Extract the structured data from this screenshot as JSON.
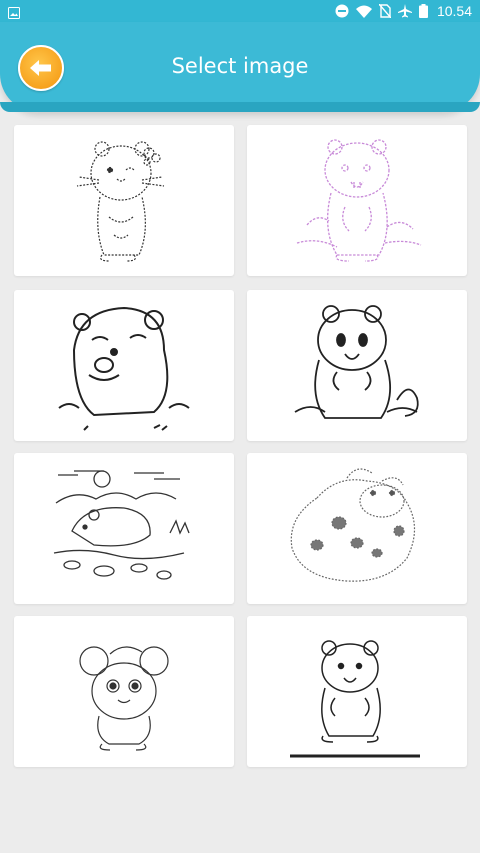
{
  "status_bar": {
    "time": "10.54",
    "icons": [
      "image-icon",
      "dnd-icon",
      "wifi-icon",
      "no-sim-icon",
      "airplane-icon",
      "battery-icon"
    ]
  },
  "header": {
    "title": "Select image",
    "back_icon": "arrow-left-icon"
  },
  "colors": {
    "header": "#3cbad6",
    "back_button": "#f7a31f",
    "background": "#ececec",
    "lilac_outline": "#c88ad8"
  },
  "images": [
    {
      "id": "hamster-flower",
      "icon": "hamster-flower-outline"
    },
    {
      "id": "hamster-standing-lilac",
      "icon": "hamster-standing-outline"
    },
    {
      "id": "hamster-eating",
      "icon": "hamster-eating-outline"
    },
    {
      "id": "hamster-smiling",
      "icon": "hamster-smiling-outline"
    },
    {
      "id": "hamster-garden",
      "icon": "hamster-garden-outline"
    },
    {
      "id": "hamster-cow",
      "icon": "cow-outline"
    },
    {
      "id": "hamster-cute",
      "icon": "hamster-cute-outline"
    },
    {
      "id": "hamster-sitting",
      "icon": "hamster-sitting-outline"
    }
  ]
}
